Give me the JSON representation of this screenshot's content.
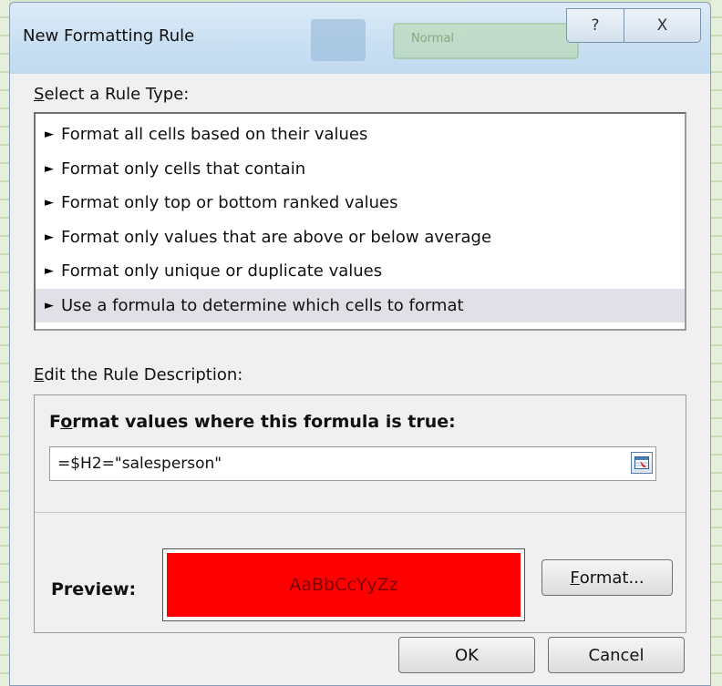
{
  "background": {
    "ghost_style_text": "Normal"
  },
  "dialog": {
    "title": "New Formatting Rule",
    "help_glyph": "?",
    "close_glyph": "X"
  },
  "rule_type": {
    "heading": "Select a Rule Type:",
    "heading_access_key": "S",
    "heading_rest": "elect a Rule Type:",
    "items": [
      {
        "label": "Format all cells based on their values",
        "selected": false
      },
      {
        "label": "Format only cells that contain",
        "selected": false
      },
      {
        "label": "Format only top or bottom ranked values",
        "selected": false
      },
      {
        "label": "Format only values that are above or below average",
        "selected": false
      },
      {
        "label": "Format only unique or duplicate values",
        "selected": false
      },
      {
        "label": "Use a formula to determine which cells to format",
        "selected": true
      }
    ],
    "bullet_glyph": "►"
  },
  "description": {
    "heading_access_key": "E",
    "heading_rest": "dit the Rule Description:",
    "formula_label_pre": "F",
    "formula_label_key": "o",
    "formula_label_rest": "rmat values where this formula is true:",
    "formula_value": "=$H2=\"salesperson\"",
    "preview_label": "Preview:",
    "preview_sample": "AaBbCcYyZz",
    "preview_fill_color": "#ff0000",
    "format_button_key": "F",
    "format_button_rest": "ormat..."
  },
  "footer": {
    "ok_label": "OK",
    "cancel_label": "Cancel"
  }
}
